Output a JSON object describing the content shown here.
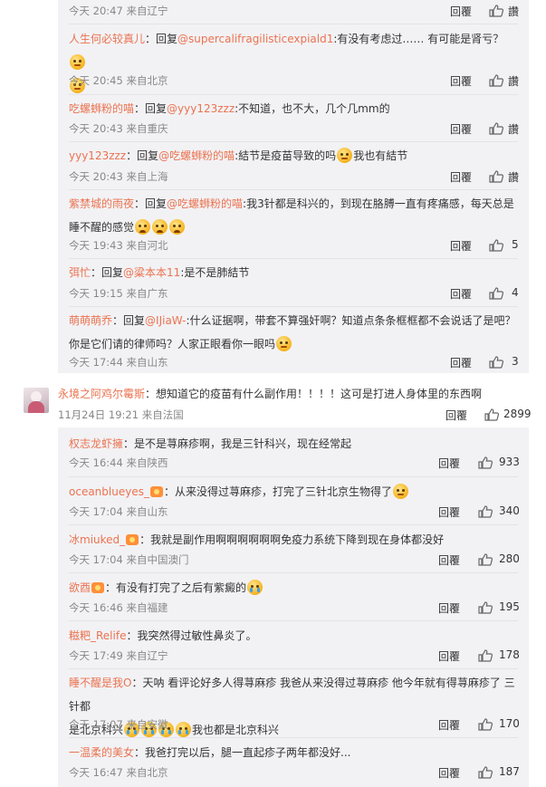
{
  "labels": {
    "reply": "回覆",
    "like_text": "讚"
  },
  "group1": [
    {
      "meta": "今天 20:47 来自辽宁",
      "like": "讚"
    },
    {
      "user": "人生何必较真儿",
      "pre": "：回复",
      "mention": "@supercalifragilisticexpiald1",
      "text": ":有没有考虑过…… 有可能是肾亏？",
      "meta": "今天 20:45 来自北京",
      "like": "讚"
    },
    {
      "user": "吃螺蛳粉的喵",
      "pre": "：回复",
      "mention": "@yyy123zzz",
      "text": ":不知道，也不大，几个几mm的",
      "meta": "今天 20:43 来自重庆",
      "like": "讚"
    },
    {
      "user": "yyy123zzz",
      "pre": "：回复",
      "mention": "@吃螺蛳粉的喵",
      "text": ":結节是疫苗导致的吗",
      "text2": "我也有結节",
      "meta": "今天 20:43 来自上海",
      "like": "讚"
    },
    {
      "user": "紫禁城的雨夜",
      "pre": "：回复",
      "mention": "@吃螺蛳粉的喵",
      "text": ":我3针都是科兴的，到现在胳膊一直有疼痛感，每天总是",
      "line2": "睡不醒的感觉",
      "meta": "今天 19:43 来自河北",
      "like": "5"
    },
    {
      "user": "弭忙",
      "pre": "：回复",
      "mention": "@粱本本11",
      "text": ":是不是肺結节",
      "meta": "今天 19:15 来自广东",
      "like": "4"
    },
    {
      "user": "萌萌萌乔",
      "pre": "：回复",
      "mention": "@IJiaW-",
      "text": ":什么证据啊，带套不算强奸啊？知道点条条框框都不会说话了是吧？",
      "line2": "你是它们请的律师吗？人家正眼看你一眼吗",
      "meta": "今天 17:44 来自山东",
      "like": "3"
    }
  ],
  "top": {
    "user": "永境之阿鸡尔霉斯",
    "text": "：想知道它的疫苗有什么副作用！！！！这可是打进人身体里的东西啊",
    "meta": "11月24日 19:21 来自法国",
    "like": "2899"
  },
  "group2": [
    {
      "user": "权志龙虾擁",
      "text": "：是不是荨麻疹啊，我是三针科兴，现在经常起",
      "meta": "今天 16:44 来自陕西",
      "like": "933"
    },
    {
      "user": "oceanblueyes_",
      "text": "：从来没得过荨麻疹，打完了三针北京生物得了",
      "meta": "今天 17:04 来自山东",
      "like": "340"
    },
    {
      "user": "冰miuked_",
      "text": "：我就是副作用啊啊啊啊啊啊免疫力系统下降到现在身体都没好",
      "meta": "今天 17:04 来自中国澳门",
      "like": "280"
    },
    {
      "user": "欲酉",
      "text": "：有没有打完了之后有紫癜的",
      "meta": "今天 16:46 来自福建",
      "like": "195"
    },
    {
      "user": "糍粑_Relife",
      "text": "：我突然得过敏性鼻炎了。",
      "meta": "今天 17:49 来自辽宁",
      "like": "178"
    },
    {
      "user": "睡不醒是我O",
      "text": "：天呐 看评论好多人得荨麻疹 我爸从来没得过荨麻疹 他今年就有得荨麻疹了 三针都",
      "line2": "是北京科兴",
      "text2": "我也都是北京科兴",
      "meta": "今天 17:07 来自安徽",
      "like": "170"
    },
    {
      "user": "一温柔的美女",
      "text": "：我爸打完以后，腿一直起疹子两年都没好...",
      "meta": "今天 16:47 来自北京",
      "like": "187"
    }
  ]
}
